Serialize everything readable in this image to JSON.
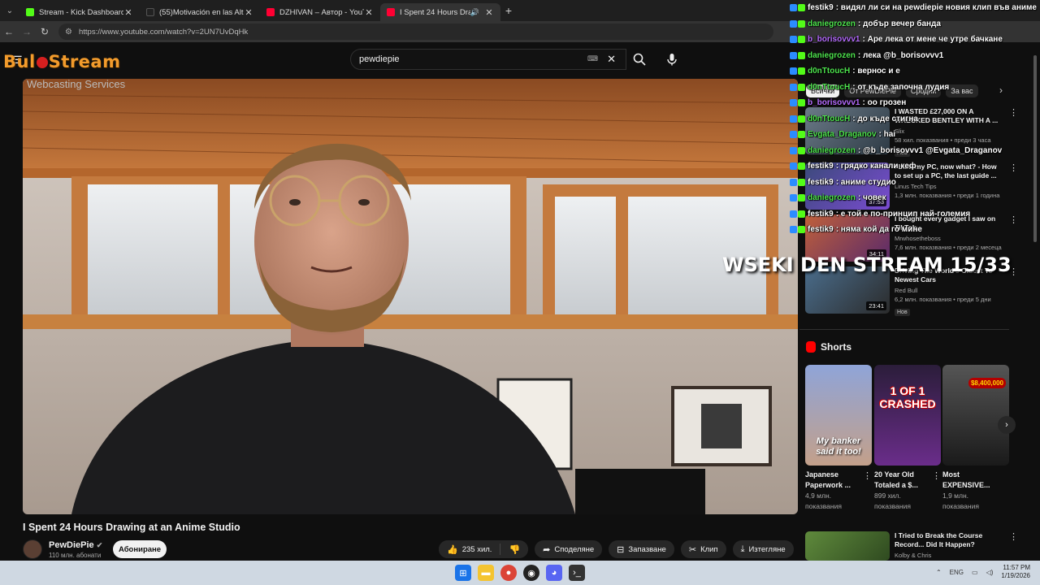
{
  "browser": {
    "tabs": [
      {
        "title": "Stream - Kick Dashboard",
        "favicon_color": "#53fc18",
        "active": false
      },
      {
        "title": "(55)Motivación en las Alturas: E",
        "favicon_color": "#222222",
        "active": false
      },
      {
        "title": "DZHIVAN – Автор - YouTube",
        "favicon_color": "#ff0033",
        "active": false
      },
      {
        "title": "I Spent 24 Hours Drawing a",
        "favicon_color": "#ff0033",
        "active": true
      }
    ],
    "url": "https://www.youtube.com/watch?v=2UN7UvDqHk"
  },
  "overlay": {
    "logo_left": "Bul",
    "logo_right": "Stream",
    "logo_sub": "Webcasting Services",
    "stream_title": "WSEKI DEN STREAM 15/33"
  },
  "search": {
    "value": "pewdiepie"
  },
  "video": {
    "title": "I Spent 24 Hours Drawing at an Anime Studio",
    "channel": "PewDiePie",
    "subscribers": "110 млн. абонати",
    "subscribe_label": "Абониране",
    "likes": "235 хил.",
    "share_label": "Споделяне",
    "save_label": "Запазване",
    "clip_label": "Клип",
    "download_label": "Изтегляне"
  },
  "sidebar": {
    "chips": [
      "Всички",
      "От PewDiePie",
      "Сродни",
      "За вас"
    ],
    "recs": [
      {
        "title": "I WASTED £27,000 ON A WRECKED BENTLEY WITH A ...",
        "channel": "Slix",
        "meta": "58 хил. показвания • преди 3 часа",
        "badge": "Нов",
        "duration": ""
      },
      {
        "title": "I built my PC, now what? - How to set up a PC, the last guide ...",
        "channel": "Linus Tech Tips",
        "meta": "1,3 млн. показвания • преди 1 година",
        "badge": "",
        "duration": "37:53"
      },
      {
        "title": "I bought every gadget I saw on TikTok",
        "channel": "Mrwhosetheboss",
        "meta": "7,6 млн. показвания • преди 2 месеца",
        "badge": "",
        "duration": "34:11"
      },
      {
        "title": "Driving The World's Oldest To Newest Cars",
        "channel": "Red Bull",
        "meta": "6,2 млн. показвания • преди 5 дни",
        "badge": "Нов",
        "duration": "23:41"
      },
      {
        "title": "I Tried to Break the Course Record... Did It Happen?",
        "channel": "Kolby & Chris",
        "meta": "",
        "badge": "",
        "duration": ""
      }
    ],
    "shorts_heading": "Shorts",
    "shorts": [
      {
        "title": "Japanese Paperwork ...",
        "views": "4,9 млн.",
        "views_label": "показвания",
        "caption": "My banker said it too!"
      },
      {
        "title": "20 Year Old Totaled a $...",
        "views": "899 хил.",
        "views_label": "показвания",
        "caption": "1 OF 1 CRASHED"
      },
      {
        "title": "Most EXPENSIVE...",
        "views": "1,9 млн.",
        "views_label": "показвания",
        "caption": "$8,400,000"
      }
    ]
  },
  "chat": [
    {
      "user": "festik9",
      "color": "#ffffff",
      "msg": ": видял ли си на pewdiepie новия клип във аниме"
    },
    {
      "user": "daniegrozen",
      "color": "#4ee44e",
      "msg": ": добър вечер банда"
    },
    {
      "user": "b_borisovvv1",
      "color": "#b66cff",
      "msg": ": Аре лека от мене че утре бачкане"
    },
    {
      "user": "daniegrozen",
      "color": "#4ee44e",
      "msg": ": лека @b_borisovvv1"
    },
    {
      "user": "d0nTtoucH",
      "color": "#4ee44e",
      "msg": ": вернос и е"
    },
    {
      "user": "d0nTtoucH",
      "color": "#4ee44e",
      "msg": ": от къде започна лудия"
    },
    {
      "user": "b_borisovvv1",
      "color": "#b66cff",
      "msg": ": оо грозен"
    },
    {
      "user": "d0nTtoucH",
      "color": "#4ee44e",
      "msg": ": до къде стигна"
    },
    {
      "user": "Evgata_Draganov",
      "color": "#4ee44e",
      "msg": ": hai"
    },
    {
      "user": "daniegrozen",
      "color": "#4ee44e",
      "msg": ": @b_borisovvv1 @Evgata_Draganov"
    },
    {
      "user": "festik9",
      "color": "#ffffff",
      "msg": ": грядко канали кеф"
    },
    {
      "user": "festik9",
      "color": "#ffffff",
      "msg": ": аниме студио"
    },
    {
      "user": "daniegrozen",
      "color": "#4ee44e",
      "msg": ": човек"
    },
    {
      "user": "festik9",
      "color": "#ffffff",
      "msg": ": е той е по-принцип най-големия"
    },
    {
      "user": "festik9",
      "color": "#ffffff",
      "msg": ": няма кой да го мине"
    }
  ],
  "taskbar": {
    "lang": "ENG",
    "time": "11:57 PM",
    "date": "1/19/2026"
  }
}
